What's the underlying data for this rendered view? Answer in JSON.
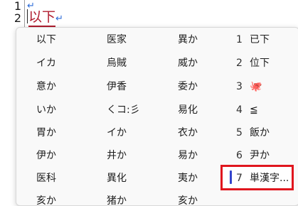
{
  "editor": {
    "line_numbers": [
      "1",
      "2"
    ],
    "line1_mark": "↵",
    "composition_text": "以下",
    "line2_mark": "↵"
  },
  "candidates": {
    "col1": [
      "以下",
      "イカ",
      "意か",
      "いか",
      "胃か",
      "伊か",
      "医科",
      "亥か"
    ],
    "col2": [
      "医家",
      "烏賊",
      "伊香",
      "くコ:彡",
      "イか",
      "井か",
      "異化",
      "猪か"
    ],
    "col3": [
      "異か",
      "威か",
      "委か",
      "易化",
      "衣か",
      "易か",
      "夷か",
      "亥か"
    ],
    "numbered": [
      {
        "num": "1",
        "text": "已下"
      },
      {
        "num": "2",
        "text": "位下"
      },
      {
        "num": "3",
        "text": "🐙"
      },
      {
        "num": "4",
        "text": "≦"
      },
      {
        "num": "5",
        "text": "飯か"
      },
      {
        "num": "6",
        "text": "尹か"
      },
      {
        "num": "7",
        "text": "単漢字..."
      }
    ]
  },
  "colors": {
    "highlight_border": "#e0161e",
    "selection_bar": "#3344cc",
    "composition": "#b01c2e"
  }
}
